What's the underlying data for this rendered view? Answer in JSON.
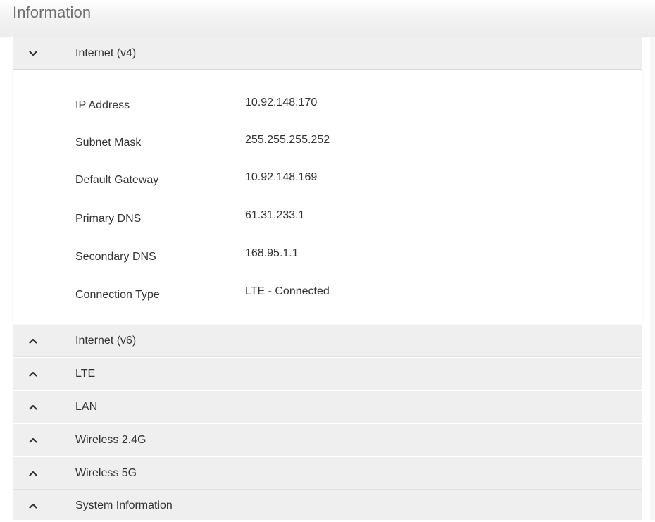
{
  "page": {
    "title": "Information"
  },
  "sections": [
    {
      "label": "Internet (v4)",
      "state": "expanded",
      "icon": "chevron-down-icon"
    },
    {
      "label": "Internet (v6)",
      "state": "collapsed",
      "icon": "chevron-up-icon"
    },
    {
      "label": "LTE",
      "state": "collapsed",
      "icon": "chevron-up-icon"
    },
    {
      "label": "LAN",
      "state": "collapsed",
      "icon": "chevron-up-icon"
    },
    {
      "label": "Wireless 2.4G",
      "state": "collapsed",
      "icon": "chevron-up-icon"
    },
    {
      "label": "Wireless 5G",
      "state": "collapsed",
      "icon": "chevron-up-icon"
    },
    {
      "label": "System Information",
      "state": "collapsed",
      "icon": "chevron-up-icon"
    }
  ],
  "internet_v4": {
    "rows": [
      {
        "label": "IP Address",
        "value": "10.92.148.170"
      },
      {
        "label": "Subnet Mask",
        "value": "255.255.255.252"
      },
      {
        "label": "Default Gateway",
        "value": "10.92.148.169"
      },
      {
        "label": "Primary DNS",
        "value": "61.31.233.1"
      },
      {
        "label": "Secondary DNS",
        "value": "168.95.1.1"
      },
      {
        "label": "Connection Type",
        "value": "LTE - Connected"
      }
    ]
  }
}
